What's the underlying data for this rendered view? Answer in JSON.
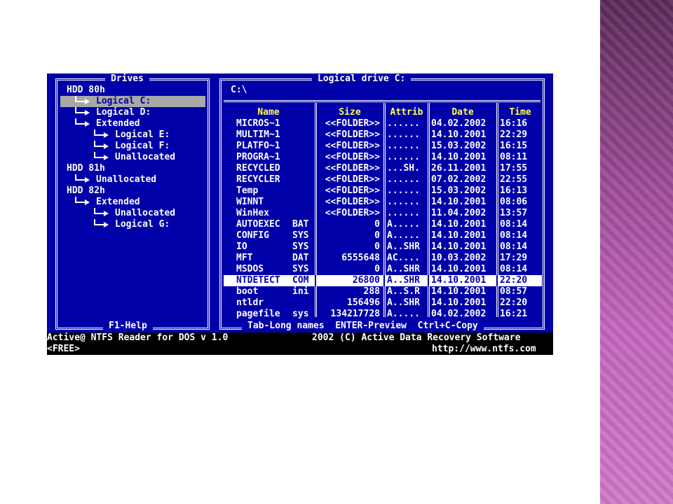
{
  "app": {
    "name": "Active@ NTFS Reader for DOS v 1.0",
    "copyright": "2002 (C) Active Data Recovery Software",
    "free_label": "<FREE>",
    "website": "http://www.ntfs.com"
  },
  "drives_panel": {
    "title": "Drives",
    "items": [
      {
        "label": "HDD 80h",
        "level": 0
      },
      {
        "label": "Logical C:",
        "level": 1,
        "selected": true
      },
      {
        "label": "Logical D:",
        "level": 1
      },
      {
        "label": "Extended",
        "level": 1
      },
      {
        "label": "Logical E:",
        "level": 2
      },
      {
        "label": "Logical F:",
        "level": 2
      },
      {
        "label": "Unallocated",
        "level": 2
      },
      {
        "label": "HDD 81h",
        "level": 0
      },
      {
        "label": "Unallocated",
        "level": 1
      },
      {
        "label": "HDD 82h",
        "level": 0
      },
      {
        "label": "Extended",
        "level": 1
      },
      {
        "label": "Unallocated",
        "level": 2
      },
      {
        "label": "Logical G:",
        "level": 2
      }
    ],
    "help_label": "F1-Help"
  },
  "files_panel": {
    "title": "Logical drive C:",
    "path": "C:\\",
    "columns": [
      "Name",
      "Size",
      "Attrib",
      "Date",
      "Time"
    ],
    "rows": [
      {
        "name": "MICROS~1",
        "ext": "",
        "size": "<<FOLDER>>",
        "attrib": "......",
        "date": "04.02.2002",
        "time": "16:16"
      },
      {
        "name": "MULTIM~1",
        "ext": "",
        "size": "<<FOLDER>>",
        "attrib": "......",
        "date": "14.10.2001",
        "time": "22:29"
      },
      {
        "name": "PLATFO~1",
        "ext": "",
        "size": "<<FOLDER>>",
        "attrib": "......",
        "date": "15.03.2002",
        "time": "16:15"
      },
      {
        "name": "PROGRA~1",
        "ext": "",
        "size": "<<FOLDER>>",
        "attrib": "......",
        "date": "14.10.2001",
        "time": "08:11"
      },
      {
        "name": "RECYCLED",
        "ext": "",
        "size": "<<FOLDER>>",
        "attrib": "...SH.",
        "date": "26.11.2001",
        "time": "17:55"
      },
      {
        "name": "RECYCLER",
        "ext": "",
        "size": "<<FOLDER>>",
        "attrib": "......",
        "date": "07.02.2002",
        "time": "22:55"
      },
      {
        "name": "Temp",
        "ext": "",
        "size": "<<FOLDER>>",
        "attrib": "......",
        "date": "15.03.2002",
        "time": "16:13"
      },
      {
        "name": "WINNT",
        "ext": "",
        "size": "<<FOLDER>>",
        "attrib": "......",
        "date": "14.10.2001",
        "time": "08:06"
      },
      {
        "name": "WinHex",
        "ext": "",
        "size": "<<FOLDER>>",
        "attrib": "......",
        "date": "11.04.2002",
        "time": "13:57"
      },
      {
        "name": "AUTOEXEC",
        "ext": "BAT",
        "size": "0",
        "attrib": "A.....",
        "date": "14.10.2001",
        "time": "08:14"
      },
      {
        "name": "CONFIG",
        "ext": "SYS",
        "size": "0",
        "attrib": "A.....",
        "date": "14.10.2001",
        "time": "08:14"
      },
      {
        "name": "IO",
        "ext": "SYS",
        "size": "0",
        "attrib": "A..SHR",
        "date": "14.10.2001",
        "time": "08:14"
      },
      {
        "name": "MFT",
        "ext": "DAT",
        "size": "6555648",
        "attrib": "AC....",
        "date": "10.03.2002",
        "time": "17:29"
      },
      {
        "name": "MSDOS",
        "ext": "SYS",
        "size": "0",
        "attrib": "A..SHR",
        "date": "14.10.2001",
        "time": "08:14"
      },
      {
        "name": "NTDETECT",
        "ext": "COM",
        "size": "26800",
        "attrib": "A..SHR",
        "date": "14.10.2001",
        "time": "22:20",
        "selected": true
      },
      {
        "name": "boot",
        "ext": "ini",
        "size": "288",
        "attrib": "A..S.R",
        "date": "14.10.2001",
        "time": "08:57"
      },
      {
        "name": "ntldr",
        "ext": "",
        "size": "156496",
        "attrib": "A..SHR",
        "date": "14.10.2001",
        "time": "22:20"
      },
      {
        "name": "pagefile",
        "ext": "sys",
        "size": "134217728",
        "attrib": "A.....",
        "date": "04.02.2002",
        "time": "16:21"
      }
    ],
    "hints": "Tab-Long names  ENTER-Preview  Ctrl+C-Copy"
  },
  "colors": {
    "background": "#0000a8",
    "text": "#ffffff",
    "header": "#ffff55",
    "drive_selection": "#a8a8a8",
    "status_bar": "#000000"
  }
}
